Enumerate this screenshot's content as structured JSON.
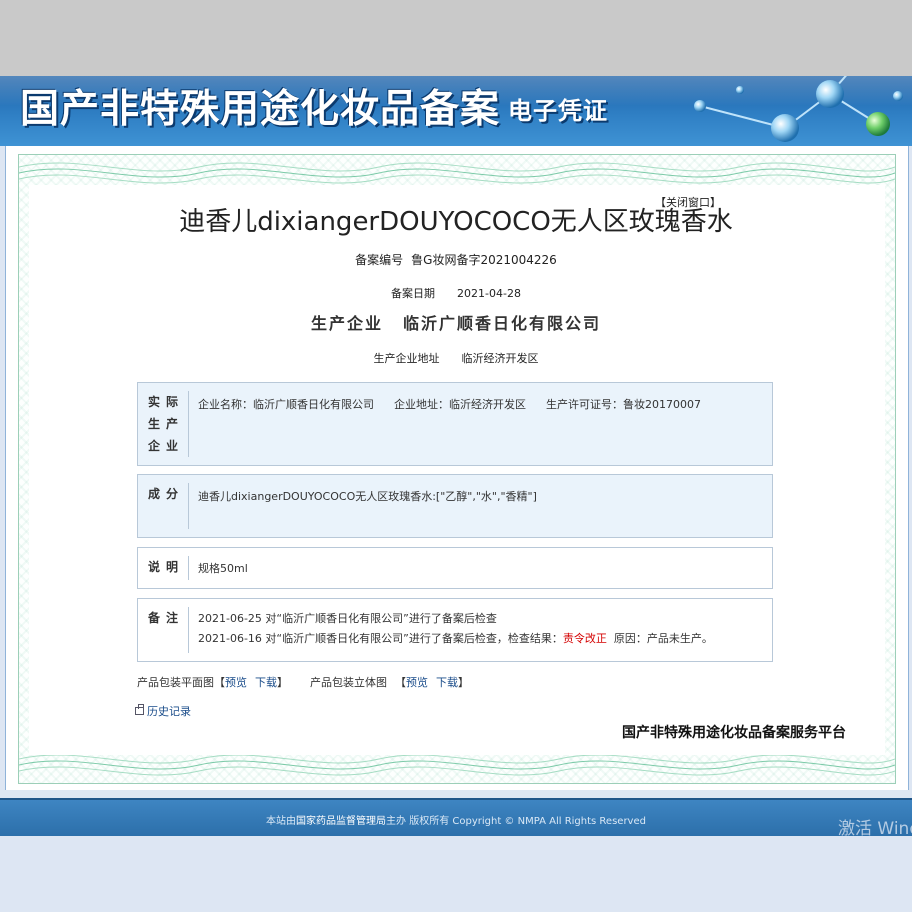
{
  "banner": {
    "title": "国产非特殊用途化妆品备案",
    "subtitle": "电子凭证"
  },
  "header": {
    "close_label": "【关闭窗口】",
    "product_name": "迪香儿dixiangerDOUYOCOCO无人区玫瑰香水"
  },
  "record": {
    "number_label": "备案编号",
    "number_value": "鲁G妆网备字2021004226",
    "date_label": "备案日期",
    "date_value": "2021-04-28",
    "producer_label": "生产企业",
    "producer_value": "临沂广顺香日化有限公司",
    "address_label": "生产企业地址",
    "address_value": "临沂经济开发区"
  },
  "actual_producer": {
    "label_chars": [
      "实际",
      "生产",
      "企业"
    ],
    "name": "企业名称：临沂广顺香日化有限公司",
    "address": "企业地址：临沂经济开发区",
    "license": "生产许可证号：鲁妆20170007"
  },
  "ingredients": {
    "label": "成分",
    "text": "迪香儿dixiangerDOUYOCOCO无人区玫瑰香水:[\"乙醇\",\"水\",\"香精\"]"
  },
  "description": {
    "label": "说明",
    "text": "规格50ml"
  },
  "remarks": {
    "label": "备注",
    "line1": "2021-06-25 对“临沂广顺香日化有限公司”进行了备案后检查",
    "line2_prefix": "2021-06-16 对“临沂广顺香日化有限公司”进行了备案后检查，检查结果：",
    "line2_result": "责令改正",
    "line2_suffix": "原因：产品未生产。",
    "result_color": "#d40000"
  },
  "links": {
    "flat_label": "产品包装平面图",
    "stereo_label": "产品包装立体图",
    "bracket_open": "【",
    "bracket_close": "】",
    "preview": "预览",
    "download": "下载",
    "history": "历史记录"
  },
  "platform_name": "国产非特殊用途化妆品备案服务平台",
  "footer": {
    "prefix": "本站由",
    "org": "国家药品监督管理局",
    "suffix": "主办 版权所有 Copyright © NMPA All Rights Reserved"
  },
  "watermark": "激活 Windows",
  "colors": {
    "banner_blue": "#2f7fc4",
    "footer_blue": "#2b6ea9",
    "box_blue": "#eaf3fb",
    "link_blue": "#1a4c8a"
  }
}
